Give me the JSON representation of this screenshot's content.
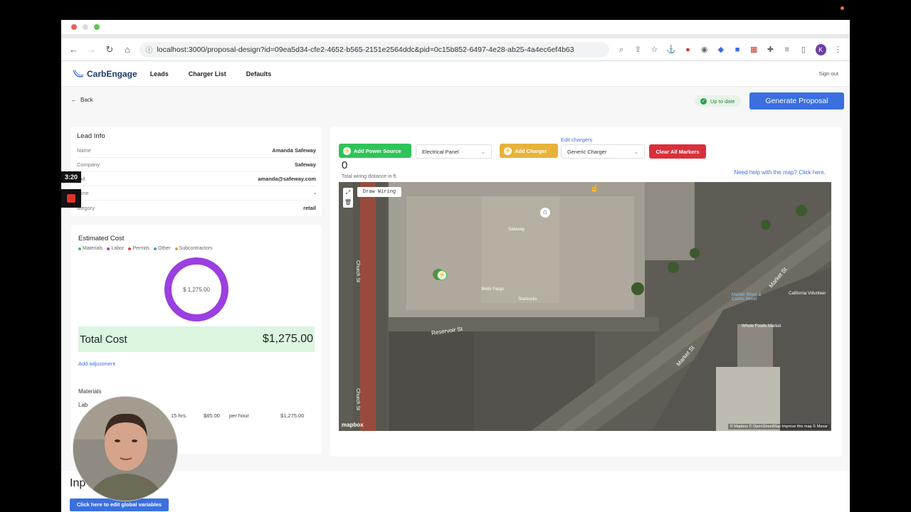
{
  "browser": {
    "url": "localhost:3000/proposal-design?id=09ea5d34-cfe2-4652-b565-2151e2564ddc&pid=0c15b852-6497-4e28-ab25-4a4ec6ef4b63",
    "profile_initial": "K"
  },
  "app": {
    "brand": "CarbEngage",
    "nav": [
      "Leads",
      "Charger List",
      "Defaults"
    ],
    "signout": "Sign out"
  },
  "header": {
    "back": "Back",
    "status": "Up to date",
    "generate": "Generate Proposal"
  },
  "lead": {
    "title": "Lead Info",
    "rows": [
      {
        "k": "Name",
        "v": "Amanda Safeway"
      },
      {
        "k": "Company",
        "v": "Safeway"
      },
      {
        "k": "nail",
        "v": "amanda@safeway.com"
      },
      {
        "k": "hone",
        "v": "-"
      },
      {
        "k": "ategory",
        "v": "retail"
      }
    ]
  },
  "cost": {
    "title": "Estimated Cost",
    "legend": [
      {
        "name": "Materials",
        "color": "#3cc85a"
      },
      {
        "name": "Labor",
        "color": "#9b3fe0"
      },
      {
        "name": "Permits",
        "color": "#e0403a"
      },
      {
        "name": "Other",
        "color": "#3b9de0"
      },
      {
        "name": "Subcontractors",
        "color": "#e0a03a"
      }
    ],
    "donut_center": "$ 1,275.00",
    "total_label": "Total Cost",
    "total_value": "$1,275.00",
    "add_adjustment": "Add adjustment",
    "materials_label": "Materials",
    "labor_label": "Lab",
    "labor_row": {
      "hours": "15 hrs.",
      "rate": "$85.00",
      "unit": "per hour",
      "amount": "$1,275.00"
    }
  },
  "map_panel": {
    "add_power": "Add Power Source",
    "panel_select": "Electrical Panel",
    "add_charger": "Add Charger",
    "edit_chargers": "Edit chargers",
    "charger_select": "Generic Charger",
    "clear_markers": "Clear All Markers",
    "wiring_value": "0",
    "wiring_caption": "Total wiring distance in ft.",
    "help": "Need help with the map? Click here.",
    "draw_wiring": "Draw Wiring",
    "streets": [
      "Church St",
      "Reservoir St",
      "Market St",
      "Church St",
      "Market St"
    ],
    "pois": [
      "Safeway",
      "Wells Fargo",
      "Starbucks",
      "Market Street & Castro Street",
      "California Volunteer",
      "Whole Foods Market"
    ],
    "attribution": "© Mapbox © OpenStreetMap Improve this map © Maxar",
    "mapbox": "mapbox"
  },
  "bottom": {
    "heading": "Inp",
    "global_button": "Click here to edit global variables"
  },
  "recorder": {
    "time": "3:20"
  }
}
